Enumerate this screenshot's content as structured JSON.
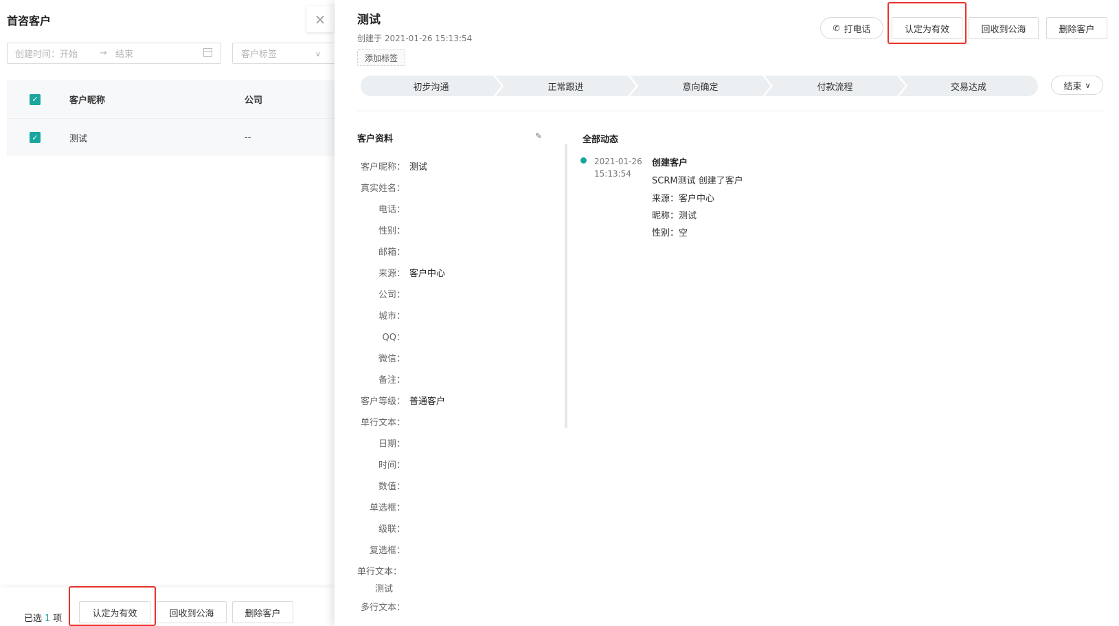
{
  "left_panel": {
    "title": "首咨客户",
    "close_icon": "close-icon",
    "date_filter": {
      "label": "创建时间：",
      "start": "开始",
      "end": "结束"
    },
    "tag_filter_placeholder": "客户标签",
    "table": {
      "headers": [
        "客户昵称",
        "公司"
      ],
      "rows": [
        {
          "name": "测试",
          "company": "--"
        }
      ]
    },
    "footer": {
      "selected_prefix": "已选",
      "selected_count": "1",
      "selected_suffix": "项",
      "buttons": [
        "认定为有效",
        "回收到公海",
        "删除客户"
      ]
    }
  },
  "drawer": {
    "title": "测试",
    "created": "创建于 2021-01-26 15:13:54",
    "add_tag": "添加标签",
    "header_buttons": {
      "call": "打电话",
      "valid": "认定为有效",
      "recycle": "回收到公海",
      "delete": "删除客户"
    },
    "stages": [
      "初步沟通",
      "正常跟进",
      "意向确定",
      "付款流程",
      "交易达成"
    ],
    "end_button": "结束",
    "profile_title": "客户资料",
    "fields": [
      {
        "label": "客户昵称：",
        "value": "测试"
      },
      {
        "label": "真实姓名：",
        "value": ""
      },
      {
        "label": "电话：",
        "value": ""
      },
      {
        "label": "性别：",
        "value": ""
      },
      {
        "label": "邮箱：",
        "value": ""
      },
      {
        "label": "来源：",
        "value": "客户中心"
      },
      {
        "label": "公司：",
        "value": ""
      },
      {
        "label": "城市：",
        "value": ""
      },
      {
        "label": "QQ：",
        "value": ""
      },
      {
        "label": "微信：",
        "value": ""
      },
      {
        "label": "备注：",
        "value": ""
      },
      {
        "label": "客户等级：",
        "value": "普通客户"
      },
      {
        "label": "单行文本：",
        "value": ""
      },
      {
        "label": "日期：",
        "value": ""
      },
      {
        "label": "时间：",
        "value": ""
      },
      {
        "label": "数值：",
        "value": ""
      },
      {
        "label": "单选框：",
        "value": ""
      },
      {
        "label": "级联：",
        "value": ""
      },
      {
        "label": "复选框：",
        "value": ""
      },
      {
        "label": "单行文本：",
        "value": "测试"
      },
      {
        "label": "多行文本：",
        "value": ""
      }
    ],
    "activity_title": "全部动态",
    "activity": {
      "date": "2021-01-26",
      "time": "15:13:54",
      "title": "创建客户",
      "lines": [
        "SCRM测试 创建了客户",
        "来源：客户中心",
        "昵称：测试",
        "性别：空"
      ]
    }
  },
  "colors": {
    "accent": "#1aa59e",
    "highlight": "#e8322b",
    "stage_bg": "#eceff1"
  }
}
